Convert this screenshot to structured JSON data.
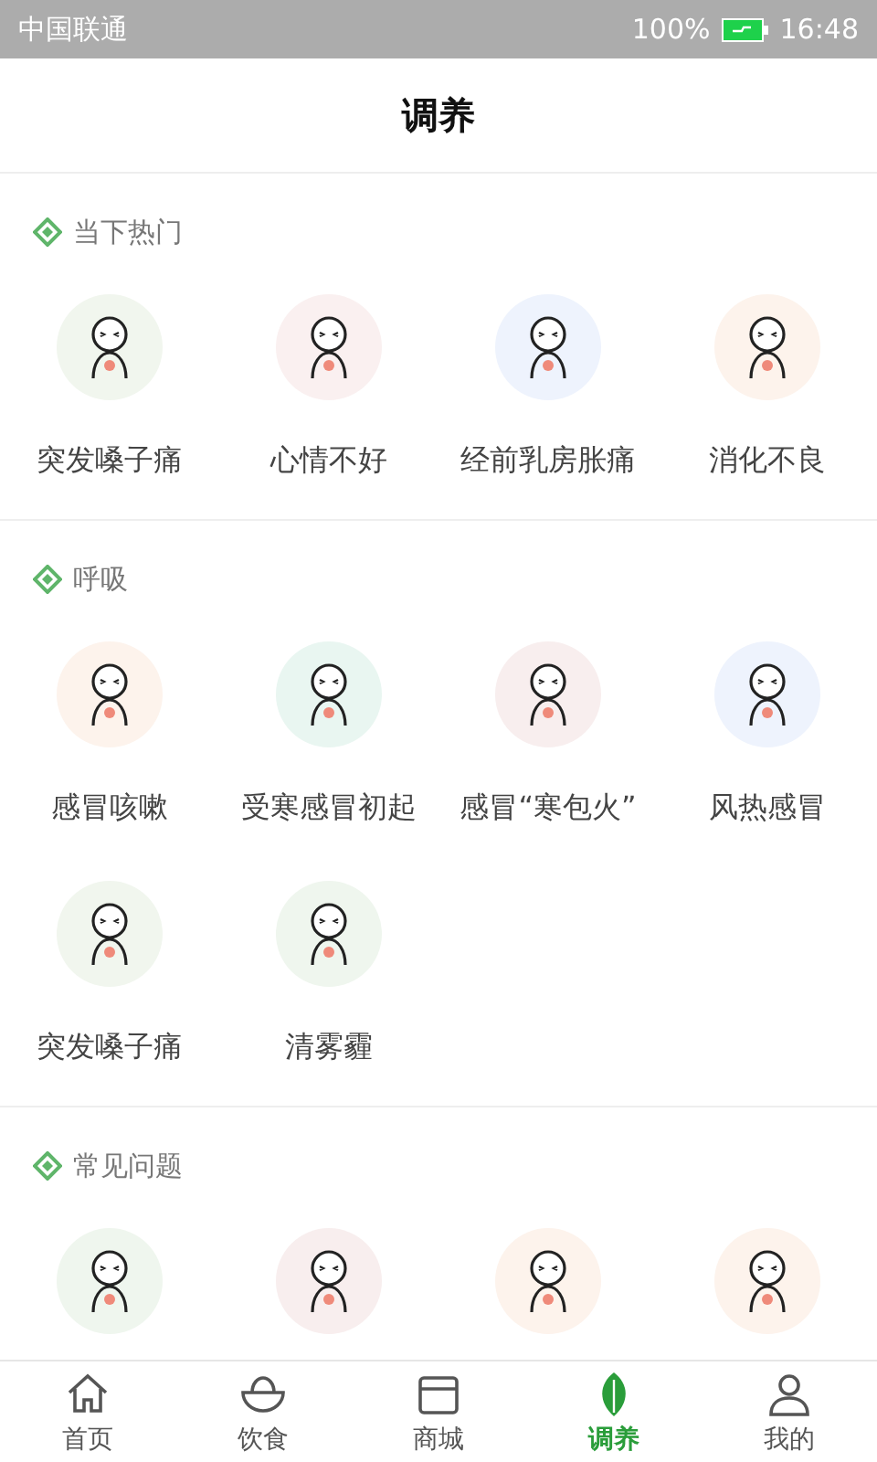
{
  "status_bar": {
    "carrier": "中国联通",
    "battery": "100%",
    "time": "16:48"
  },
  "header": {
    "title": "调养"
  },
  "sections": [
    {
      "title": "当下热门",
      "items": [
        {
          "label": "突发嗓子痛",
          "color": "#f1f6ee"
        },
        {
          "label": "心情不好",
          "color": "#faf0f0"
        },
        {
          "label": "经前乳房胀痛",
          "color": "#eef3fd"
        },
        {
          "label": "消化不良",
          "color": "#fdf3ec"
        }
      ]
    },
    {
      "title": "呼吸",
      "items": [
        {
          "label": "感冒咳嗽",
          "color": "#fdf3ec"
        },
        {
          "label": "受寒感冒初起",
          "color": "#e9f6f1"
        },
        {
          "label": "感冒“寒包火”",
          "color": "#f8eeee"
        },
        {
          "label": "风热感冒",
          "color": "#eef3fd"
        },
        {
          "label": "突发嗓子痛",
          "color": "#f1f6ee"
        },
        {
          "label": "清雾霾",
          "color": "#eff6ee"
        }
      ]
    },
    {
      "title": "常见问题",
      "items": [
        {
          "color": "#eff6ee"
        },
        {
          "color": "#f8eeee"
        },
        {
          "color": "#fdf3ec"
        },
        {
          "color": "#fdf3ec"
        }
      ]
    }
  ],
  "tabs": [
    {
      "label": "首页",
      "kind": "home",
      "selected": false
    },
    {
      "label": "饮食",
      "kind": "bowl",
      "selected": false
    },
    {
      "label": "商城",
      "kind": "store",
      "selected": false
    },
    {
      "label": "调养",
      "kind": "leaf",
      "selected": true
    },
    {
      "label": "我的",
      "kind": "user",
      "selected": false
    }
  ]
}
